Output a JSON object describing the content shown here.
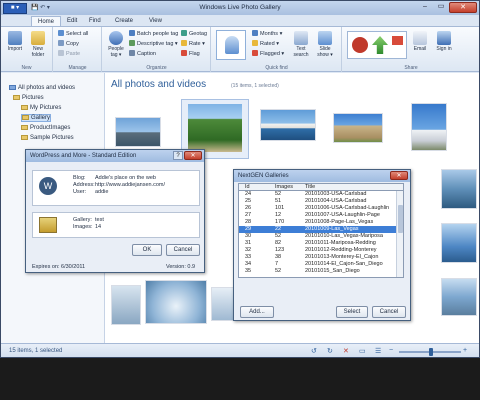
{
  "window": {
    "title": "Windows Live Photo Gallery",
    "app_menu": "■ ▾",
    "qat": "💾 ↶ ▾"
  },
  "controls": {
    "min": "–",
    "max": "▭",
    "close": "✕"
  },
  "tabs": [
    "Home",
    "Edit",
    "Find",
    "Create",
    "View"
  ],
  "ribbon": {
    "groups": {
      "new": "New",
      "manage": "Manage",
      "organize": "Organize",
      "quickfind": "Quick find",
      "share": "Share"
    },
    "import": "Import",
    "new_folder": "New folder",
    "select_all": "Select all",
    "copy": "Copy",
    "paste": "Paste",
    "people_tag": "People tag ▾",
    "batch_people": "Batch people tag",
    "descriptive": "Descriptive tag ▾",
    "caption": "Caption",
    "geotag": "Geotag",
    "rate": "Rate ▾",
    "flag": "Flag",
    "months": "Months ▾",
    "rated": "Rated ▾",
    "flagged": "Flagged ▾",
    "text_search": "Text search",
    "slide_show": "Slide show ▾",
    "email": "Email",
    "sign_in": "Sign in"
  },
  "nav": {
    "items": [
      {
        "label": "All photos and videos"
      },
      {
        "label": "Pictures"
      },
      {
        "label": "My Pictures"
      },
      {
        "label": "Gallery"
      },
      {
        "label": "ProductImages"
      },
      {
        "label": "Sample Pictures"
      }
    ]
  },
  "content": {
    "heading": "All photos and videos",
    "count": "(15 items, 1 selected)"
  },
  "status": {
    "text": "15 items, 1 selected"
  },
  "wp_dialog": {
    "title": "WordPress and More - Standard Edition",
    "help": "?",
    "close": "✕",
    "blog_label": "Blog:",
    "blog_value": "Addie's place on the web",
    "address_label": "Address:",
    "address_value": "http://www.addiejansen.com/",
    "user_label": "User:",
    "user_value": "addie",
    "gallery_label": "Gallery:",
    "gallery_value": "test",
    "images_label": "Images:",
    "images_value": "14",
    "ok": "OK",
    "cancel": "Cancel",
    "expires": "Expires on: 6/30/2011",
    "version": "Version: 0.9"
  },
  "ng_dialog": {
    "title": "NextGEN Galleries",
    "close": "✕",
    "headers": [
      "Id",
      "Images",
      "Title"
    ],
    "rows": [
      {
        "id": "24",
        "images": "52",
        "title": "20101003-USA-Carlsbad"
      },
      {
        "id": "25",
        "images": "51",
        "title": "20101004-USA-Carlsbad"
      },
      {
        "id": "26",
        "images": "101",
        "title": "20101006-USA-Carlsbad-Laughlin"
      },
      {
        "id": "27",
        "images": "12",
        "title": "20101007-USA-Laughlin-Page"
      },
      {
        "id": "28",
        "images": "170",
        "title": "20101008-Page-Las_Vegas"
      },
      {
        "id": "29",
        "images": "22",
        "title": "20101009-Las_Vegas"
      },
      {
        "id": "30",
        "images": "52",
        "title": "20101010-Las_Vegas-Mariposa"
      },
      {
        "id": "31",
        "images": "82",
        "title": "20101011-Mariposa-Redding"
      },
      {
        "id": "32",
        "images": "123",
        "title": "20101012-Redding-Monterey"
      },
      {
        "id": "33",
        "images": "38",
        "title": "20101013-Monterey-El_Cajon"
      },
      {
        "id": "34",
        "images": "7",
        "title": "20101014-El_Cajon-San_Diego"
      },
      {
        "id": "35",
        "images": "52",
        "title": "20101015_San_Diego"
      }
    ],
    "selected_index": 5,
    "add": "Add...",
    "select": "Select",
    "cancel": "Cancel"
  }
}
